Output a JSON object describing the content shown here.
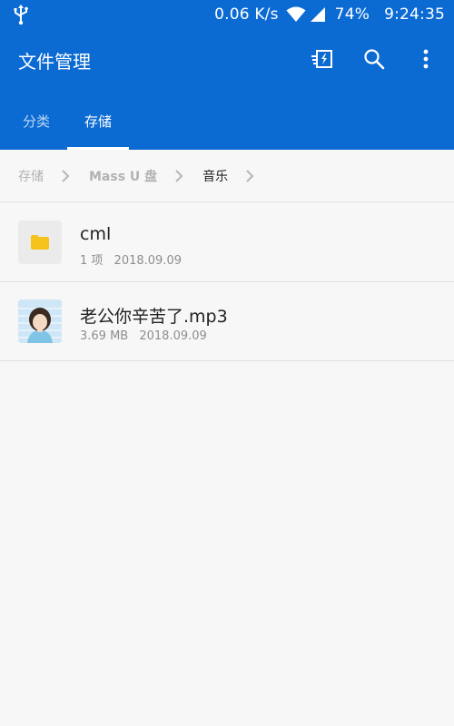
{
  "status_bar": {
    "usb_icon": "usb-icon",
    "net_speed": "0.06 K/s",
    "wifi_icon": "wifi-icon",
    "signal_icon": "signal-icon",
    "battery": "74%",
    "time": "9:24:35"
  },
  "app_bar": {
    "title": "文件管理",
    "actions": [
      {
        "icon": "transfer-icon"
      },
      {
        "icon": "search-icon"
      },
      {
        "icon": "more-vert-icon"
      }
    ],
    "tabs": [
      {
        "label": "分类",
        "active": false
      },
      {
        "label": "存储",
        "active": true
      }
    ]
  },
  "breadcrumb": {
    "items": [
      "存储",
      "Mass U 盘",
      "音乐"
    ]
  },
  "files": [
    {
      "name": "cml",
      "meta_count": "1 项",
      "meta_date": "2018.09.09",
      "type": "folder",
      "icon": "folder-icon"
    },
    {
      "name": "老公你辛苦了.mp3",
      "meta_size": "3.69 MB",
      "meta_date": "2018.09.09",
      "type": "audio",
      "icon": "album-art-thumbnail"
    }
  ],
  "colors": {
    "primary": "#0b6bd3",
    "folder": "#f6c31c",
    "background": "#f7f7f7",
    "text_primary": "#222222",
    "text_secondary": "#8e8e8e"
  }
}
